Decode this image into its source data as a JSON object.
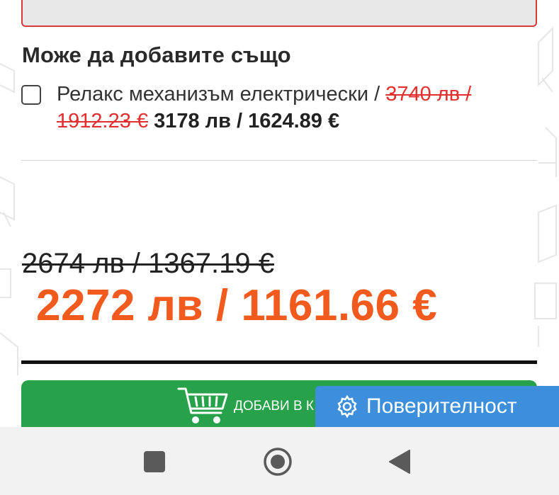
{
  "section": {
    "title": "Може да добавите също"
  },
  "addon": {
    "name": "Релакс механизъм електрически /",
    "old_price": "3740 лв / 1912.23 €",
    "new_price": "3178 лв / 1624.89 €",
    "checked": false
  },
  "product": {
    "old_price": "2674 лв / 1367.19 €",
    "price": "2272 лв / 1161.66 €"
  },
  "cart": {
    "label": "ДОБАВИ В К",
    "icon": "cart-icon"
  },
  "privacy": {
    "label": "Поверителност",
    "icon": "gear-icon"
  },
  "navbar": {
    "buttons": [
      "recent-apps",
      "home",
      "back"
    ]
  },
  "colors": {
    "price_accent": "#f25a1e",
    "strike_red": "#e23030",
    "cart_green": "#27a14a",
    "privacy_blue": "#3d8fdc"
  }
}
